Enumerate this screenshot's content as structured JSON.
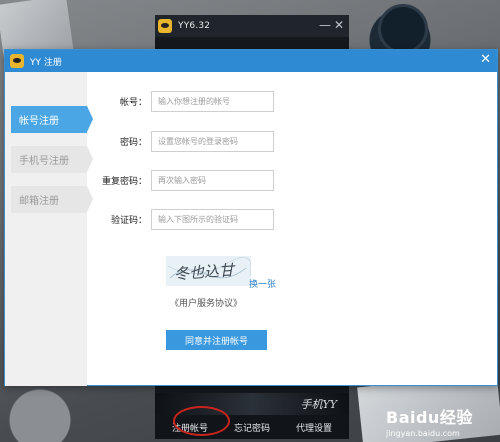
{
  "yy_window": {
    "title": "YY6.32",
    "minimize_glyph": "—",
    "close_glyph": "✕",
    "banner_text": "手机YY",
    "footer_links": [
      "注册帐号",
      "忘记密码",
      "代理设置"
    ]
  },
  "reg_dialog": {
    "title": "YY 注册",
    "close_glyph": "✕",
    "tabs": [
      "帐号注册",
      "手机号注册",
      "邮箱注册"
    ],
    "active_tab": "帐号注册",
    "fields": {
      "account": {
        "label": "帐号：",
        "placeholder": "输入你想注册的帐号"
      },
      "password": {
        "label": "密码：",
        "placeholder": "设置您帐号的登录密码"
      },
      "confirm": {
        "label": "重复密码：",
        "placeholder": "再次输入密码"
      },
      "captcha": {
        "label": "验证码：",
        "placeholder": "输入下图所示的验证码"
      }
    },
    "captcha_image_text": "冬也込甘",
    "refresh_link": "换一张",
    "terms_link": "《用户服务协议》",
    "submit_label": "同意并注册帐号"
  },
  "watermark": {
    "logo": "Baidu经验",
    "url": "jingyan.baidu.com"
  },
  "colors": {
    "title_blue": "#2e8bd3",
    "active_tab": "#4aa6e4",
    "button_blue": "#3a98de",
    "link_blue": "#2a7fc8",
    "highlight_red": "#c8251d"
  }
}
